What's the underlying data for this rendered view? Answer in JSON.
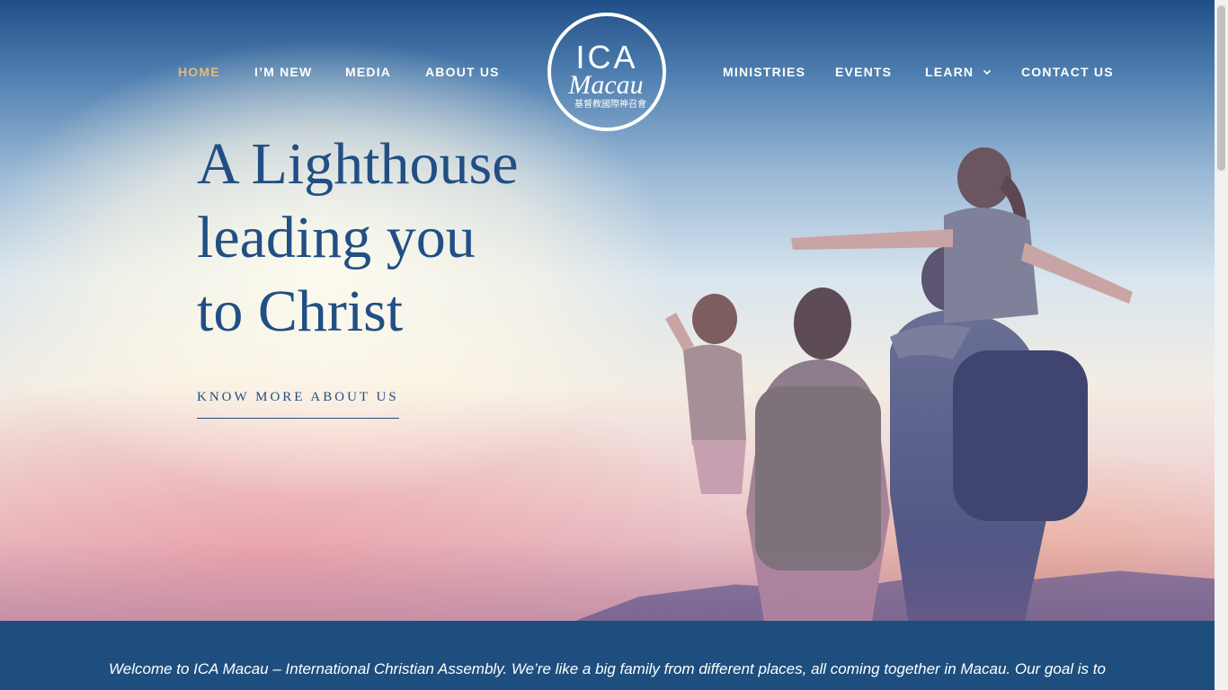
{
  "nav": {
    "left_items": [
      {
        "label": "HOME",
        "active": true
      },
      {
        "label": "I’M NEW",
        "active": false
      },
      {
        "label": "MEDIA",
        "active": false
      },
      {
        "label": "ABOUT US",
        "active": false
      }
    ],
    "right_items": [
      {
        "label": "MINISTRIES"
      },
      {
        "label": "EVENTS"
      },
      {
        "label": "LEARN",
        "has_dropdown": true
      },
      {
        "label": "CONTACT US"
      }
    ],
    "active_color": "#e4b97a"
  },
  "logo": {
    "line1": "ICA",
    "line2": "Macau",
    "subtitle": "基督教國際神召會"
  },
  "hero": {
    "headline_lines": [
      "A Lighthouse",
      "leading you",
      "to Christ"
    ],
    "cta_label": "KNOW MORE ABOUT US",
    "text_color": "#214f84"
  },
  "welcome": {
    "text": "Welcome to ICA Macau – International Christian Assembly. We’re like a big family from different places, all coming together in Macau. Our goal is to",
    "background": "#1d4e7e"
  }
}
